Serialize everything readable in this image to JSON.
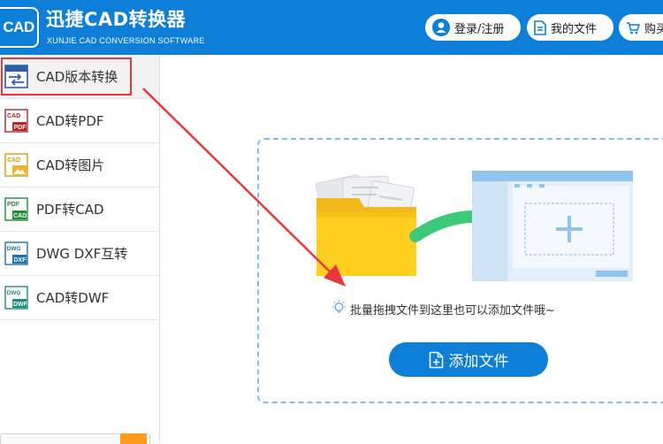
{
  "header": {
    "logo_text": "CAD",
    "app_title": "迅捷CAD转换器",
    "app_subtitle": "XUNJIE CAD CONVERSION SOFTWARE",
    "buttons": {
      "login": "登录/注册",
      "my_files": "我的文件",
      "buy": "购买"
    }
  },
  "sidebar": {
    "items": [
      {
        "label": "CAD版本转换",
        "icon": "cad-version-convert-icon",
        "active": true
      },
      {
        "label": "CAD转PDF",
        "icon": "cad-to-pdf-icon"
      },
      {
        "label": "CAD转图片",
        "icon": "cad-to-image-icon"
      },
      {
        "label": "PDF转CAD",
        "icon": "pdf-to-cad-icon"
      },
      {
        "label": "DWG DXF互转",
        "icon": "dwg-dxf-convert-icon"
      },
      {
        "label": "CAD转DWF",
        "icon": "cad-to-dwf-icon"
      }
    ]
  },
  "main": {
    "hint_text": "批量拖拽文件到这里也可以添加文件哦~",
    "add_button_label": "添加文件"
  },
  "colors": {
    "header_bg": "#0d7fd8",
    "highlight_red": "#e8363d",
    "dropzone_border": "#7dbdf0",
    "folder_yellow": "#ffd021",
    "arrow_green": "#3ec97a"
  }
}
